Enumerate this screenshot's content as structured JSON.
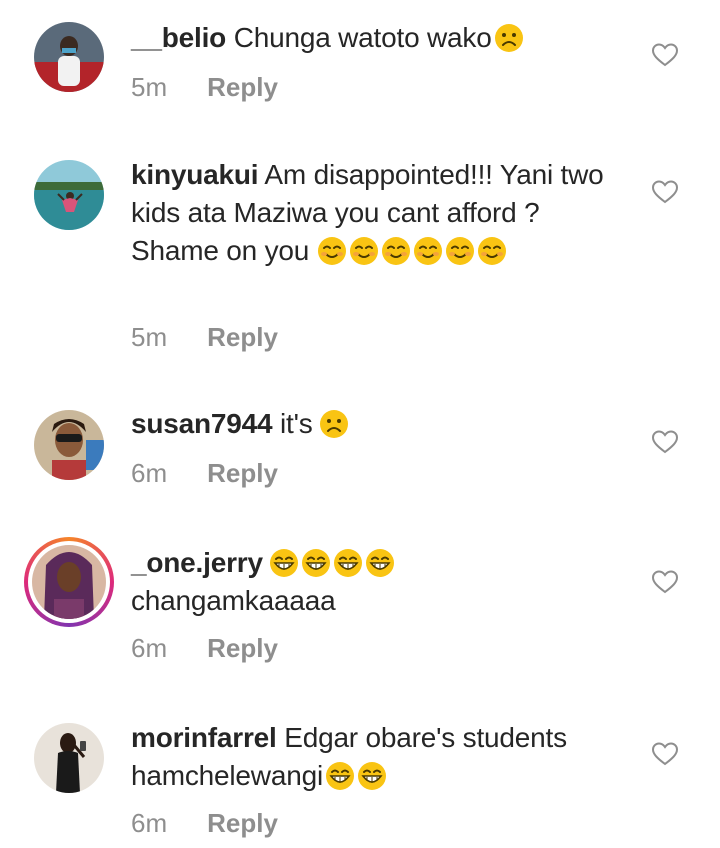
{
  "comments": [
    {
      "username": "__belio",
      "text": "Chunga watoto wako",
      "emojis": [
        "sad-face"
      ],
      "time": "5m",
      "reply_label": "Reply",
      "avatar": "profile-photo-man-red-car"
    },
    {
      "username": "kinyuakui",
      "text": "Am disappointed!!! Yani two kids ata Maziwa you cant afford ? Shame on you",
      "emojis": [
        "smiling-face",
        "smiling-face",
        "smiling-face",
        "smiling-face",
        "smiling-face",
        "smiling-face"
      ],
      "time": "5m",
      "reply_label": "Reply",
      "avatar": "profile-photo-woman-beach"
    },
    {
      "username": "susan7944",
      "text": "it's",
      "emojis": [
        "sad-face"
      ],
      "time": "6m",
      "reply_label": "Reply",
      "avatar": "profile-photo-woman-sunglasses"
    },
    {
      "username": "_one.jerry",
      "text": "changamkaaaaa",
      "emojis": [
        "grinning-face",
        "grinning-face",
        "grinning-face",
        "grinning-face"
      ],
      "time": "6m",
      "reply_label": "Reply",
      "avatar": "profile-photo-woman-braids"
    },
    {
      "username": "morinfarrel",
      "text": "Edgar obare's students hamchelewangi",
      "emojis": [
        "grinning-face",
        "grinning-face"
      ],
      "time": "6m",
      "reply_label": "Reply",
      "avatar": "profile-photo-woman-phone"
    }
  ],
  "colors": {
    "text": "#262626",
    "secondary": "#8e8e8e",
    "emoji_yellow": "#f9c413"
  }
}
